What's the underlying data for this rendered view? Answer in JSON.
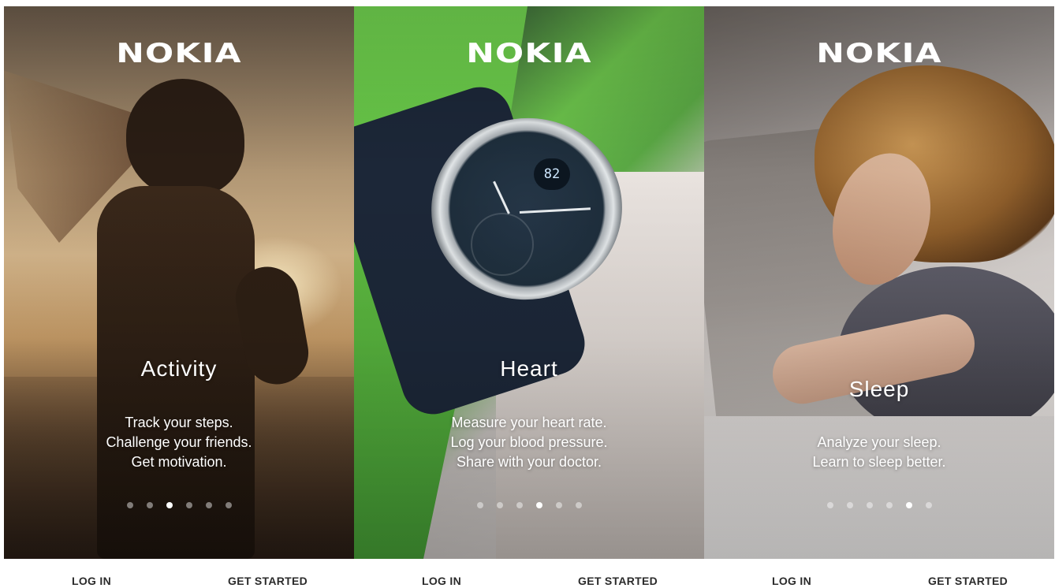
{
  "brand": {
    "logo_text": "NOKIA"
  },
  "screens": [
    {
      "id": "activity",
      "title": "Activity",
      "lines": [
        "Track your steps.",
        "Challenge your friends.",
        "Get motivation."
      ],
      "page_indicator": {
        "total": 6,
        "active_index": 2
      },
      "actions": {
        "login": "LOG IN",
        "get_started": "GET STARTED"
      }
    },
    {
      "id": "heart",
      "title": "Heart",
      "watch_readout": "82",
      "lines": [
        "Measure your heart rate.",
        "Log your blood pressure.",
        "Share with your doctor."
      ],
      "page_indicator": {
        "total": 6,
        "active_index": 3
      },
      "actions": {
        "login": "LOG IN",
        "get_started": "GET STARTED"
      }
    },
    {
      "id": "sleep",
      "title": "Sleep",
      "lines": [
        "Analyze your sleep.",
        "Learn to sleep better."
      ],
      "page_indicator": {
        "total": 6,
        "active_index": 4
      },
      "actions": {
        "login": "LOG IN",
        "get_started": "GET STARTED"
      }
    }
  ],
  "colors": {
    "text_on_photo": "#ffffff",
    "action_text": "#2b2b2b",
    "dot_inactive": "rgba(255,255,255,0.45)",
    "dot_active": "#ffffff"
  }
}
